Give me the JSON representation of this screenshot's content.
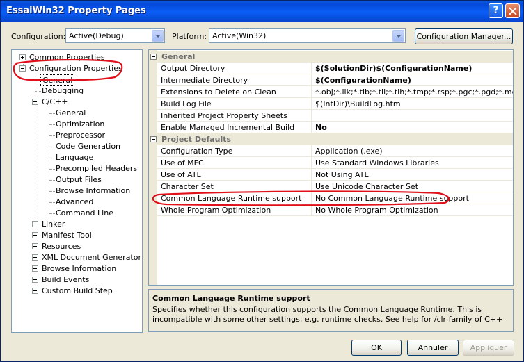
{
  "window": {
    "title": "EssaiWin32 Property Pages",
    "help_glyph": "?"
  },
  "toolbar": {
    "configuration_label": "Configuration:",
    "configuration_value": "Active(Debug)",
    "platform_label": "Platform:",
    "platform_value": "Active(Win32)",
    "config_manager_label": "Configuration Manager..."
  },
  "tree": {
    "common_properties": "Common Properties",
    "configuration_properties": "Configuration Properties",
    "general": "General",
    "debugging": "Debugging",
    "cpp": "C/C++",
    "cpp_children": [
      "General",
      "Optimization",
      "Preprocessor",
      "Code Generation",
      "Language",
      "Precompiled Headers",
      "Output Files",
      "Browse Information",
      "Advanced",
      "Command Line"
    ],
    "others": [
      "Linker",
      "Manifest Tool",
      "Resources",
      "XML Document Generator",
      "Browse Information",
      "Build Events",
      "Custom Build Step"
    ]
  },
  "grid": {
    "cat_general": "General",
    "general_rows": [
      {
        "name": "Output Directory",
        "value": "$(SolutionDir)$(ConfigurationName)"
      },
      {
        "name": "Intermediate Directory",
        "value": "$(ConfigurationName)"
      },
      {
        "name": "Extensions to Delete on Clean",
        "value": "*.obj;*.ilk;*.tlb;*.tli;*.tlh;*.tmp;*.rsp;*.pgc;*.pgd;*.meta;$("
      },
      {
        "name": "Build Log File",
        "value": "$(IntDir)\\BuildLog.htm"
      },
      {
        "name": "Inherited Project Property Sheets",
        "value": ""
      },
      {
        "name": "Enable Managed Incremental Build",
        "value": "No"
      }
    ],
    "cat_defaults": "Project Defaults",
    "default_rows": [
      {
        "name": "Configuration Type",
        "value": "Application (.exe)"
      },
      {
        "name": "Use of MFC",
        "value": "Use Standard Windows Libraries"
      },
      {
        "name": "Use of ATL",
        "value": "Not Using ATL"
      },
      {
        "name": "Character Set",
        "value": "Use Unicode Character Set"
      },
      {
        "name": "Common Language Runtime support",
        "value": "No Common Language Runtime support"
      },
      {
        "name": "Whole Program Optimization",
        "value": "No Whole Program Optimization"
      }
    ]
  },
  "description": {
    "title": "Common Language Runtime support",
    "text": "Specifies whether this configuration supports the Common Language Runtime.  This is incompatible with some other settings, e.g. runtime checks. See help for /clr family of C++ compiler switches for full list of..."
  },
  "buttons": {
    "ok": "OK",
    "cancel": "Annuler",
    "apply": "Appliquer"
  },
  "colors": {
    "annotation": "#e0101a",
    "titlebar": "#0b5ef6"
  }
}
